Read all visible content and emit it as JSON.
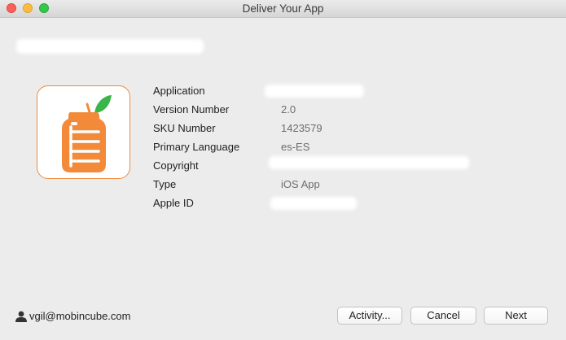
{
  "window": {
    "title": "Deliver Your App"
  },
  "app": {
    "fields": [
      {
        "label": "Application",
        "value": ""
      },
      {
        "label": "Version Number",
        "value": "2.0"
      },
      {
        "label": "SKU Number",
        "value": "1423579"
      },
      {
        "label": "Primary Language",
        "value": "es-ES"
      },
      {
        "label": "Copyright",
        "value": ""
      },
      {
        "label": "Type",
        "value": "iOS App"
      },
      {
        "label": "Apple ID",
        "value": ""
      }
    ]
  },
  "footer": {
    "account": "vgil@mobincube.com",
    "activity_label": "Activity...",
    "cancel_label": "Cancel",
    "next_label": "Next"
  },
  "colors": {
    "icon_orange": "#f28a3a",
    "leaf_green": "#3bb54a"
  }
}
